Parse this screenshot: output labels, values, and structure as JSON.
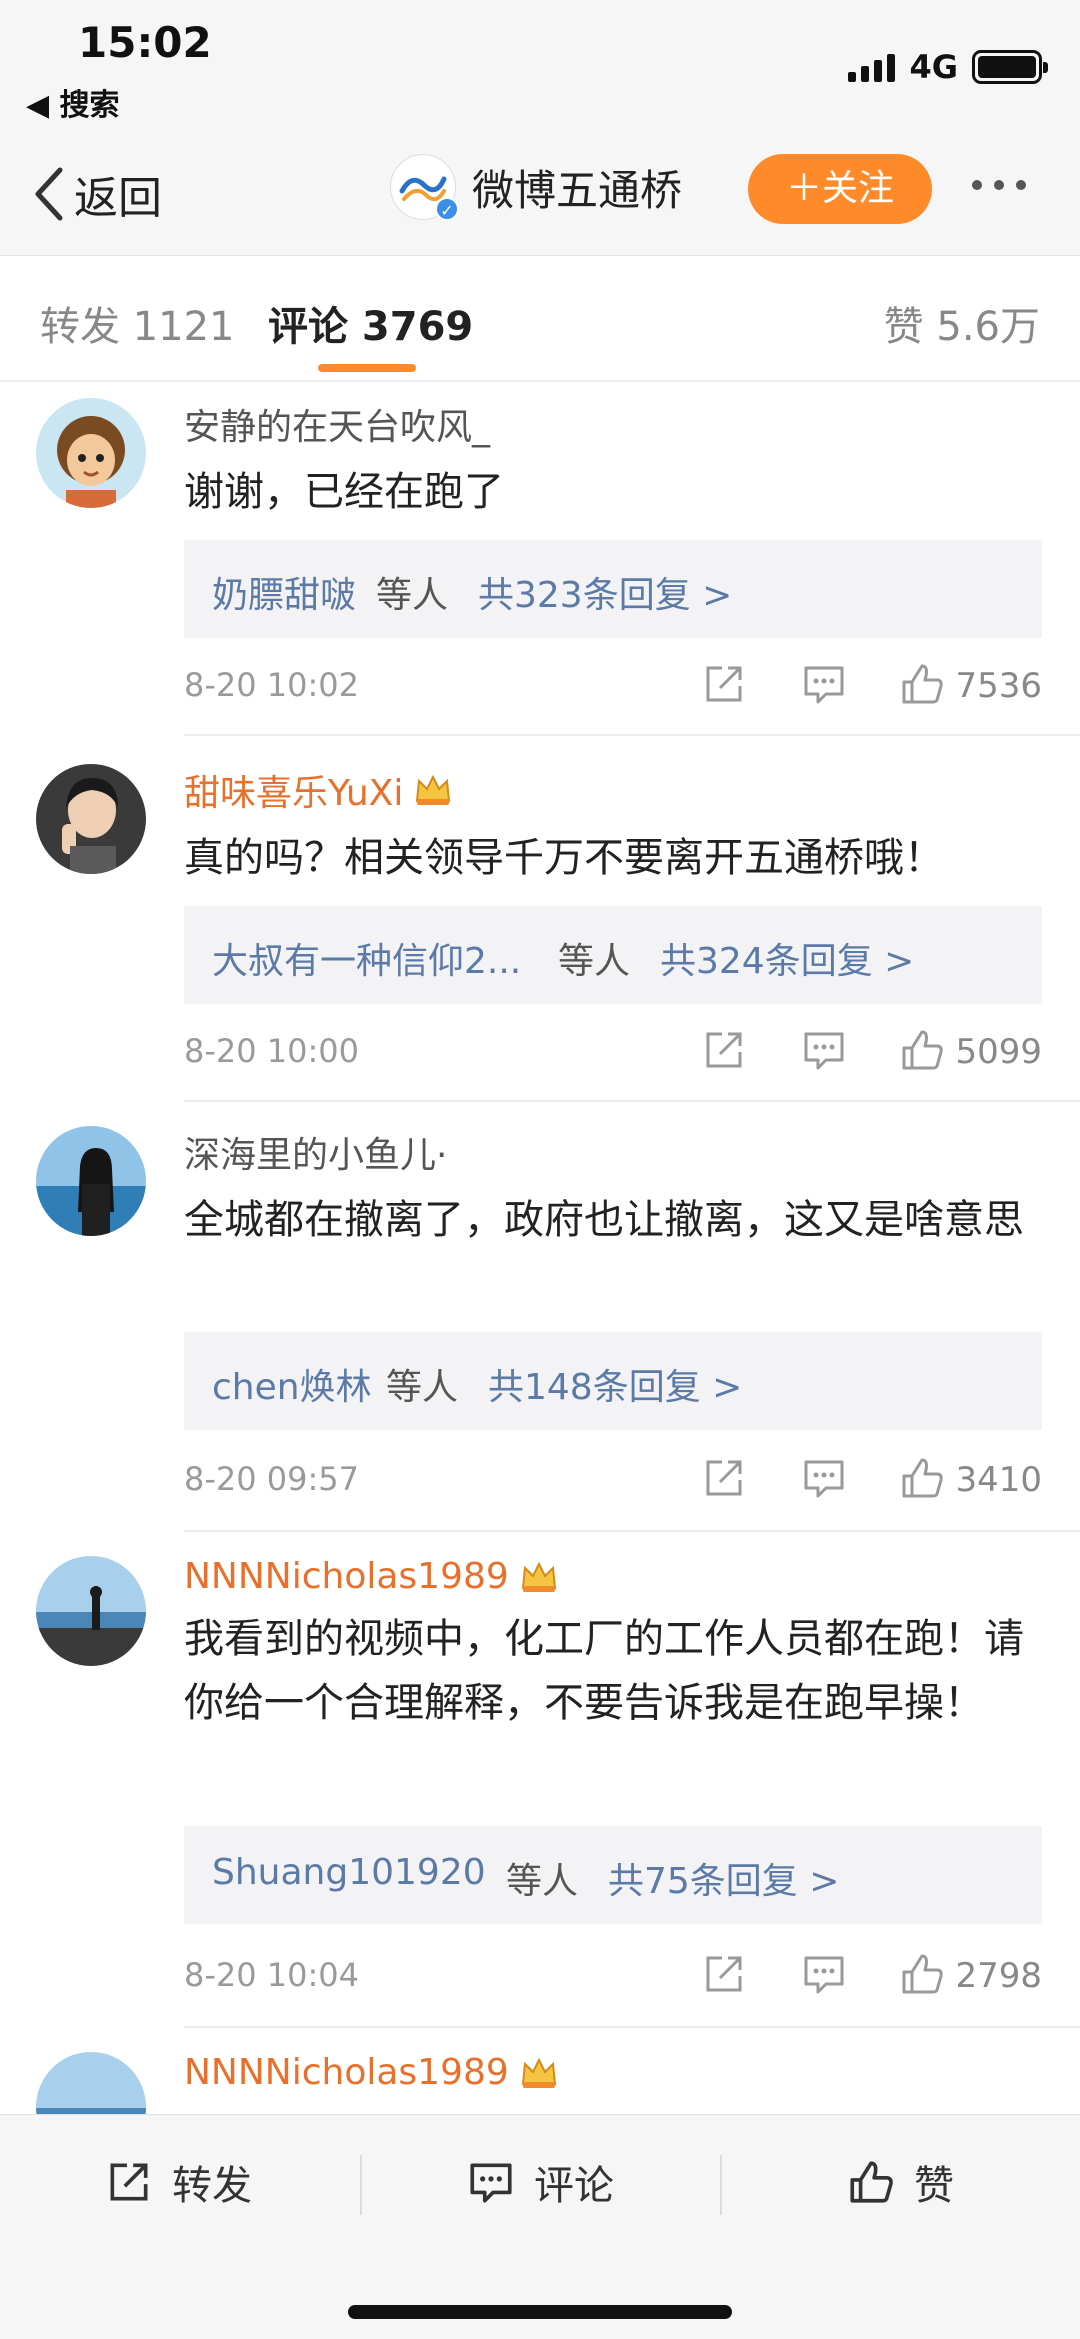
{
  "status_bar": {
    "time": "15:02",
    "back_app": "◀ 搜索",
    "network": "4G",
    "battery_level": 1.0
  },
  "nav": {
    "back_label": "返回",
    "account_name": "微博五通桥",
    "follow_label": "＋关注"
  },
  "tabs": {
    "repost": "转发 1121",
    "comments": "评论 3769",
    "likes": "赞 5.6万"
  },
  "colors": {
    "accent": "#ff8a2a",
    "vip_name": "#e8702a",
    "reply_link": "#5b7aa6"
  },
  "comments": [
    {
      "username": "安静的在天台吹风_",
      "vip": false,
      "text": "谢谢，已经在跑了",
      "reply_names": "奶膘甜啵",
      "reply_etc": "等人",
      "reply_count": "共323条回复 >",
      "time": "8-20 10:02",
      "likes": "7536"
    },
    {
      "username": "甜味喜乐YuXi",
      "vip": true,
      "text": "真的吗？相关领导千万不要离开五通桥哦！",
      "reply_names": "大叔有一种信仰2...",
      "reply_etc": "等人",
      "reply_count": "共324条回复 >",
      "time": "8-20 10:00",
      "likes": "5099"
    },
    {
      "username": "深海里的小鱼儿·",
      "vip": false,
      "text": "全城都在撤离了，政府也让撤离，这又是啥意思",
      "reply_names": "chen焕林",
      "reply_etc": "等人",
      "reply_count": "共148条回复 >",
      "time": "8-20 09:57",
      "likes": "3410"
    },
    {
      "username": "NNNNicholas1989",
      "vip": true,
      "text": "我看到的视频中，化工厂的工作人员都在跑！请你给一个合理解释，不要告诉我是在跑早操！",
      "reply_names": "Shuang101920",
      "reply_etc": "等人",
      "reply_count": "共75条回复 >",
      "time": "8-20 10:04",
      "likes": "2798"
    },
    {
      "username": "NNNNicholas1989",
      "vip": true
    }
  ],
  "bottom_bar": {
    "repost": "转发",
    "comment": "评论",
    "like": "赞"
  },
  "icons": {
    "back": "chevron-left-icon",
    "more": "more-dots-icon",
    "share": "share-icon",
    "comment": "comment-icon",
    "like": "thumbs-up-icon",
    "crown": "crown-icon"
  }
}
